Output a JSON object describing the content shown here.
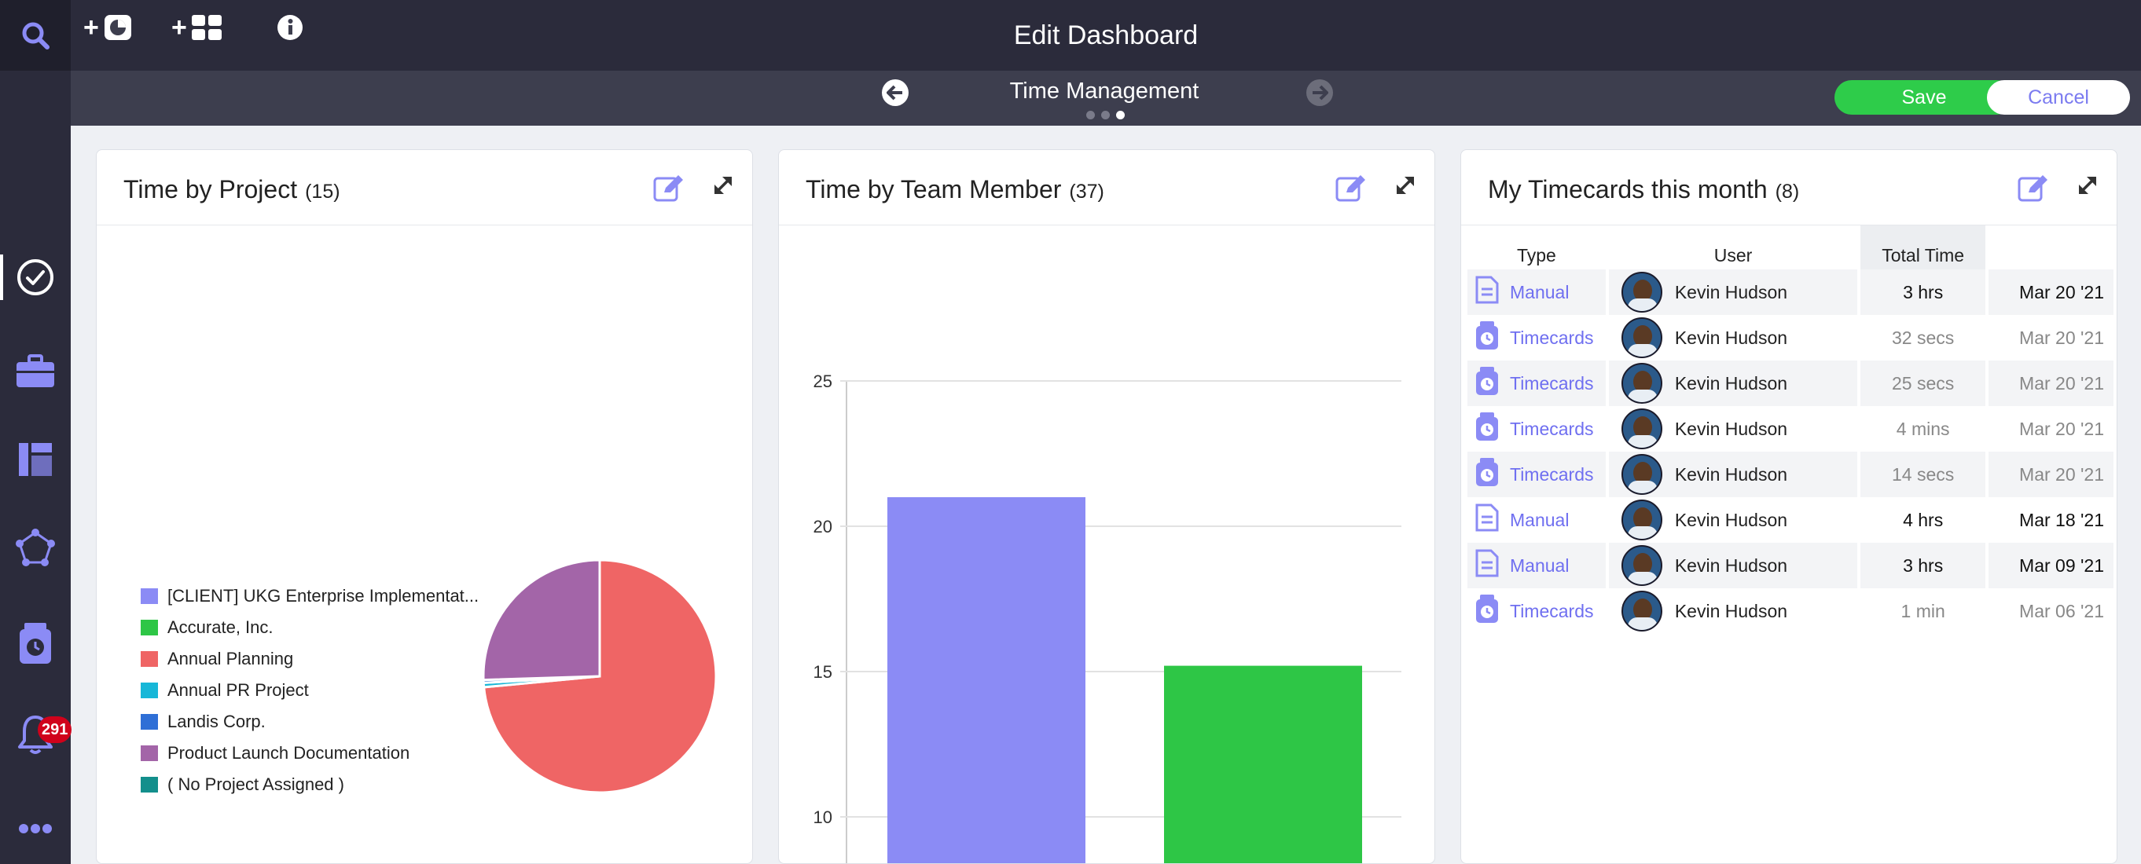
{
  "app": {
    "title": "Edit Dashboard"
  },
  "sidebar": {
    "notifications_count": "291",
    "items": [
      "search-icon",
      "check-circle-icon",
      "briefcase-icon",
      "layout-icon",
      "network-icon",
      "timecard-icon",
      "bell-icon",
      "more-icon"
    ]
  },
  "toolbar": {
    "page_title": "Time Management",
    "save_label": "Save",
    "cancel_label": "Cancel",
    "dots": 3,
    "active_dot": 2
  },
  "colors": {
    "accent": "#7b7bf0",
    "save": "#2ecc4a",
    "dark": "#2b2b3b",
    "toolbar": "#3d3e4e"
  },
  "panels": {
    "project": {
      "title": "Time by Project",
      "count": "(15)"
    },
    "team": {
      "title": "Time by Team Member",
      "count": "(37)"
    },
    "timecards": {
      "title": "My Timecards this month",
      "count": "(8)"
    }
  },
  "chart_data": [
    {
      "type": "pie",
      "legend": [
        {
          "label": "[CLIENT] UKG Enterprise Implementat...",
          "color": "#8b8bf5"
        },
        {
          "label": "Accurate, Inc.",
          "color": "#2ec646"
        },
        {
          "label": "Annual Planning",
          "color": "#ef6565"
        },
        {
          "label": "Annual PR Project",
          "color": "#17b7d8"
        },
        {
          "label": "Landis Corp.",
          "color": "#2f6fd6"
        },
        {
          "label": "Product Launch Documentation",
          "color": "#a365a8"
        },
        {
          "label": "( No Project Assigned )",
          "color": "#138f8c"
        }
      ],
      "slices": [
        {
          "label": "Annual Planning",
          "value": 73.5
        },
        {
          "label": "Annual PR Project",
          "value": 0.6
        },
        {
          "label": "Landis Corp.",
          "value": 0.4
        },
        {
          "label": "Product Launch Documentation",
          "value": 25.5
        }
      ]
    },
    {
      "type": "bar",
      "yticks": [
        10,
        15,
        20,
        25
      ],
      "ylim": [
        6.5,
        25
      ],
      "bars": [
        {
          "value": 21,
          "color": "#8b8bf5"
        },
        {
          "value": 15.2,
          "color": "#2ec646"
        }
      ]
    }
  ],
  "timecards": {
    "headers": {
      "type": "Type",
      "user": "User",
      "total": "Total Time",
      "date": ""
    },
    "rows": [
      {
        "type": "Manual",
        "icon": "document-icon",
        "user": "Kevin Hudson",
        "total": "3 hrs",
        "date": "Mar 20 '21",
        "bold": true
      },
      {
        "type": "Timecards",
        "icon": "timecard-icon",
        "user": "Kevin Hudson",
        "total": "32 secs",
        "date": "Mar 20 '21",
        "bold": false
      },
      {
        "type": "Timecards",
        "icon": "timecard-icon",
        "user": "Kevin Hudson",
        "total": "25 secs",
        "date": "Mar 20 '21",
        "bold": false
      },
      {
        "type": "Timecards",
        "icon": "timecard-icon",
        "user": "Kevin Hudson",
        "total": "4 mins",
        "date": "Mar 20 '21",
        "bold": false
      },
      {
        "type": "Timecards",
        "icon": "timecard-icon",
        "user": "Kevin Hudson",
        "total": "14 secs",
        "date": "Mar 20 '21",
        "bold": false
      },
      {
        "type": "Manual",
        "icon": "document-icon",
        "user": "Kevin Hudson",
        "total": "4 hrs",
        "date": "Mar 18 '21",
        "bold": true
      },
      {
        "type": "Manual",
        "icon": "document-icon",
        "user": "Kevin Hudson",
        "total": "3 hrs",
        "date": "Mar 09 '21",
        "bold": true
      },
      {
        "type": "Timecards",
        "icon": "timecard-icon",
        "user": "Kevin Hudson",
        "total": "1 min",
        "date": "Mar 06 '21",
        "bold": false
      }
    ]
  }
}
